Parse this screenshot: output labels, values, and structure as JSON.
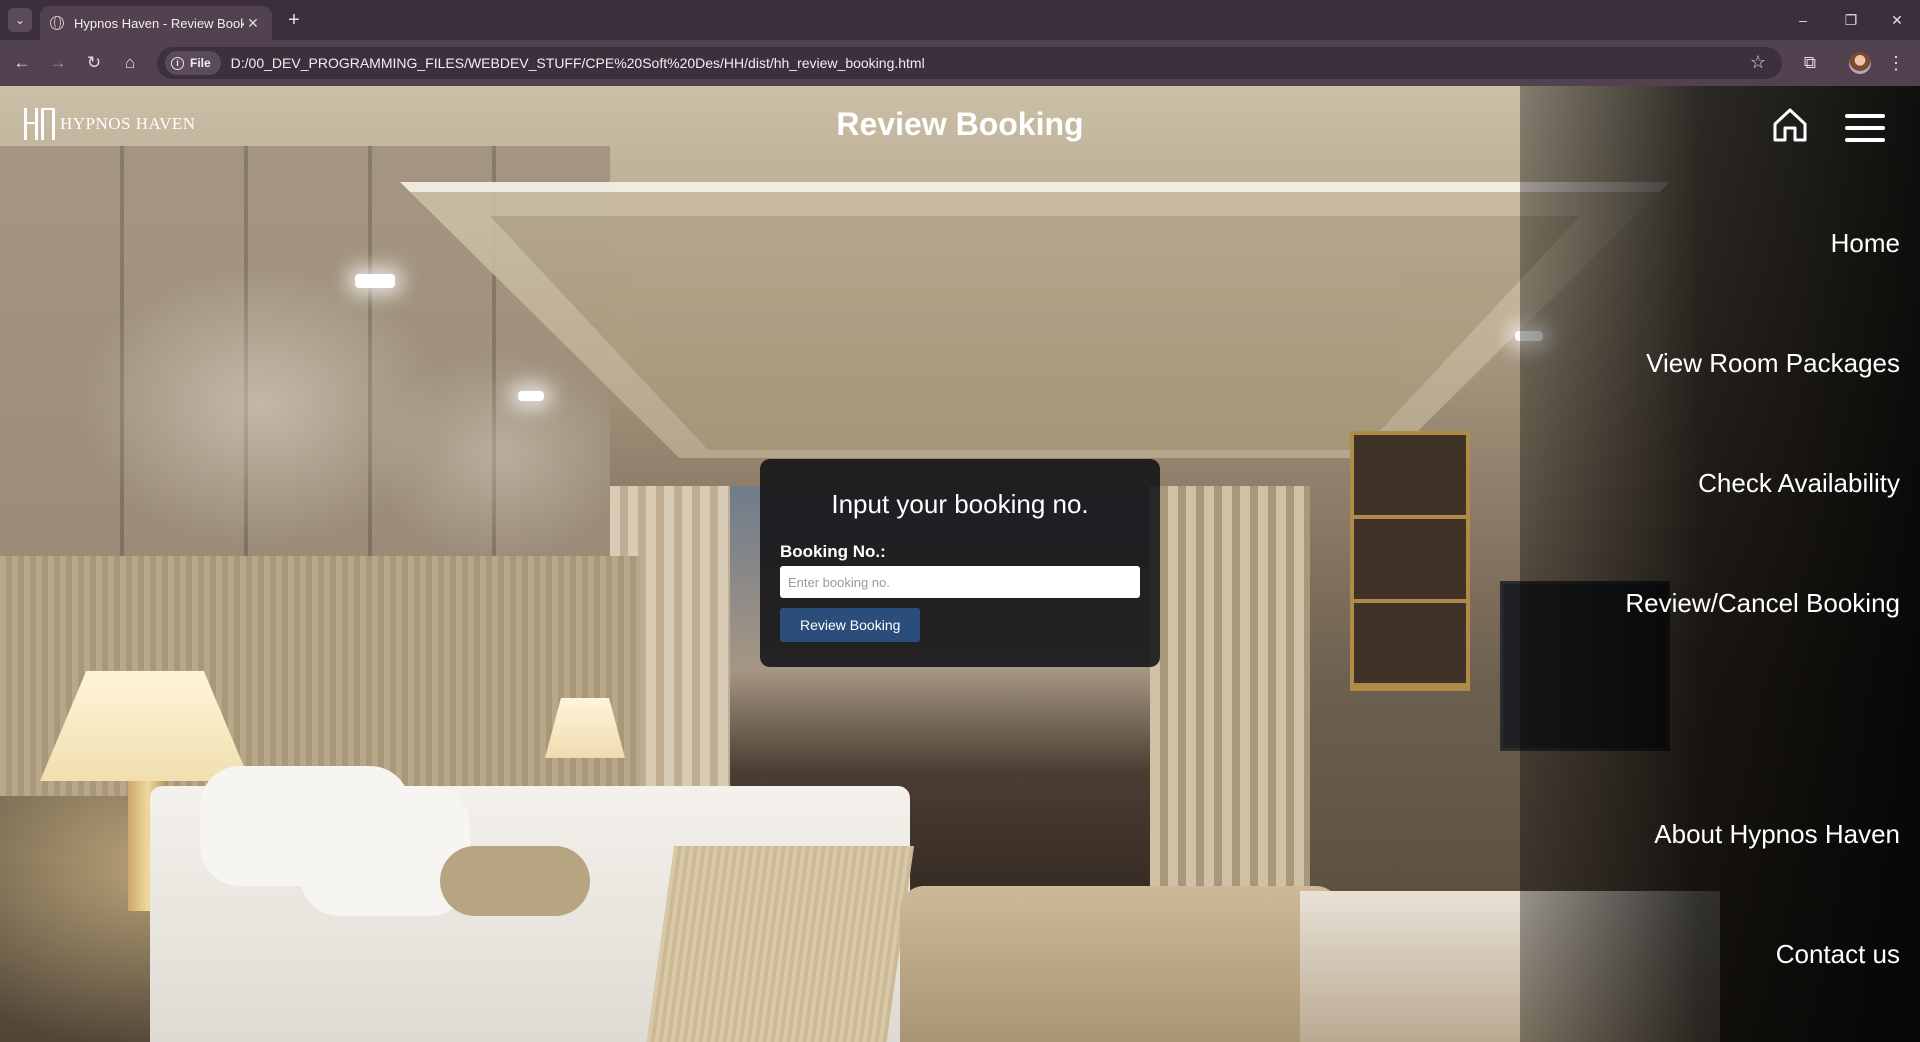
{
  "browser": {
    "tab_title": "Hypnos Haven - Review Bookin",
    "tab_close": "✕",
    "new_tab": "+",
    "scheme_chip": "File",
    "url": "D:/00_DEV_PROGRAMMING_FILES/WEBDEV_STUFF/CPE%20Soft%20Des/HH/dist/hh_review_booking.html",
    "window_controls": {
      "minimize": "–",
      "restore": "❐",
      "close": "✕"
    }
  },
  "site": {
    "logo_text": "HYPNOS HAVEN",
    "page_title": "Review Booking"
  },
  "nav": {
    "items": [
      {
        "label": "Home"
      },
      {
        "label": "View Room Packages"
      },
      {
        "label": "Check Availability"
      },
      {
        "label": "Review/Cancel Booking"
      },
      {
        "label": "About Hypnos Haven"
      },
      {
        "label": "Contact us"
      }
    ]
  },
  "booking_form": {
    "heading": "Input your booking no.",
    "field_label": "Booking No.:",
    "field_placeholder": "Enter booking no.",
    "field_value": "",
    "submit_label": "Review Booking"
  },
  "colors": {
    "chrome_dark": "#3c2f3d",
    "chrome_toolbar": "#52424f",
    "button_blue": "#2b4d7a",
    "card_bg": "#121214"
  },
  "icons": {
    "tab_search": "chevron-down-icon",
    "back": "arrow-left-icon",
    "forward": "arrow-right-icon",
    "reload": "reload-icon",
    "browser_home": "home-icon",
    "site_info": "info-icon",
    "bookmark": "star-icon",
    "extensions": "puzzle-icon",
    "site_home": "house-icon",
    "site_menu": "hamburger-icon"
  }
}
